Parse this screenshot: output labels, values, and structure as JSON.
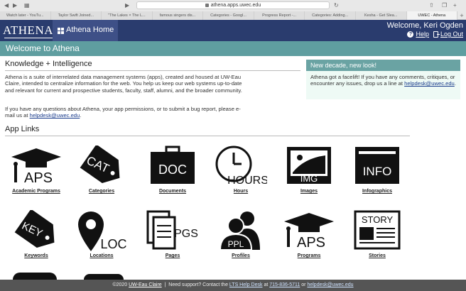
{
  "browser": {
    "url": "athena.apps.uwec.edu",
    "tabs": [
      "Watch later - YouTu...",
      "Taylor Swift Joined...",
      "\"The Lakes × The L...",
      "famous singers dis...",
      "Categories - Googl...",
      "Progress Report -...",
      "Categories: Adding...",
      "Kesha - Get Slea...",
      "UWEC - Athena"
    ]
  },
  "header": {
    "logo": "ATHENA",
    "home_label": "Athena Home",
    "welcome": "Welcome, Keri Ogden",
    "help_label": "Help",
    "logout_label": "Log Out"
  },
  "page_title": "Welcome to Athena",
  "knowledge": {
    "heading": "Knowledge + Intelligence",
    "paragraph1": "Athena is a suite of interrelated data management systems (apps), created and housed at UW-Eau Claire, intended to centralize information for the web. You help us keep our web systems up-to-date and relevant for current and prospective students, faculty, staff, alumni, and the broader community.",
    "paragraph2_text": "If you have any questions about Athena, your app permissions, or to submit a bug report, please e-mail us at",
    "email": "helpdesk@uwec.edu"
  },
  "news": {
    "heading": "New decade, new look!",
    "body": "Athena got a facelift! If you have any comments, critiques, or encounter any issues, drop us a line at",
    "email": "helpdesk@uwec.edu"
  },
  "app_links": {
    "heading": "App Links",
    "apps": [
      {
        "label": "Academic Programs",
        "icon": "mortarboard-aps-icon",
        "text": "APS"
      },
      {
        "label": "Categories",
        "icon": "tag-cat-icon",
        "text": "CAT"
      },
      {
        "label": "Documents",
        "icon": "briefcase-doc-icon",
        "text": "DOC"
      },
      {
        "label": "Hours",
        "icon": "clock-hours-icon",
        "text": "HOURS"
      },
      {
        "label": "Images",
        "icon": "picture-img-icon",
        "text": "IMG"
      },
      {
        "label": "Infographics",
        "icon": "chart-info-icon",
        "text": "INFO"
      },
      {
        "label": "Keywords",
        "icon": "tag-key-icon",
        "text": "KEY"
      },
      {
        "label": "Locations",
        "icon": "pin-loc-icon",
        "text": "LOC"
      },
      {
        "label": "Pages",
        "icon": "pages-pgs-icon",
        "text": "PGS"
      },
      {
        "label": "Profiles",
        "icon": "people-ppl-icon",
        "text": "PPL"
      },
      {
        "label": "Programs",
        "icon": "mortarboard-aps-icon",
        "text": "APS"
      },
      {
        "label": "Stories",
        "icon": "newspaper-story-icon",
        "text": "STORY"
      }
    ]
  },
  "footer": {
    "copyright": "©2020",
    "uwec": "UW-Eau Claire",
    "support": "Need support? Contact the",
    "lts": "LTS Help Desk",
    "at": "at",
    "phone": "715-836-5711",
    "or": "or",
    "email": "helpdesk@uwec.edu"
  },
  "colors": {
    "header_bg": "#2a3c6e",
    "title_bar": "#5f9ea0",
    "news_head": "#6aa3a3",
    "footer_bg": "#555555"
  }
}
